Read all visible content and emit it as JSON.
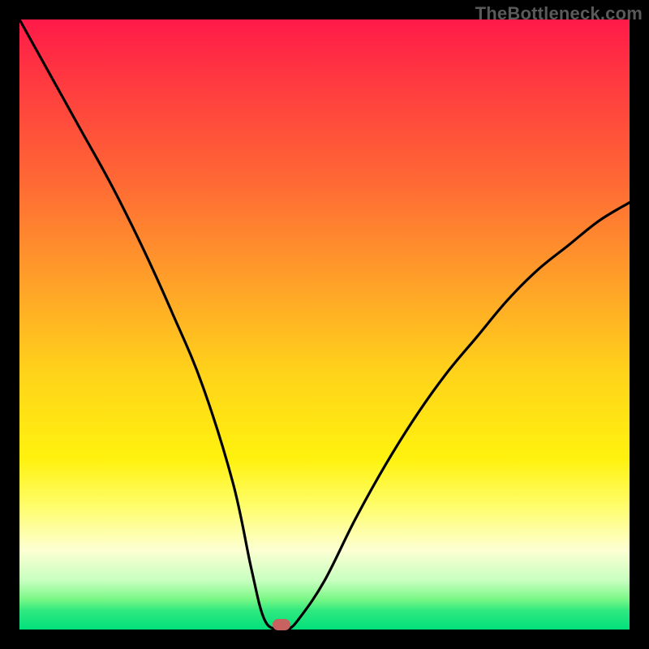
{
  "branding": {
    "text": "TheBottleneck.com"
  },
  "colors": {
    "curve": "#000000",
    "marker": "#c76260",
    "frame": "#000000"
  },
  "chart_data": {
    "type": "line",
    "title": "",
    "xlabel": "",
    "ylabel": "",
    "xlim": [
      0,
      100
    ],
    "ylim": [
      0,
      100
    ],
    "grid": false,
    "series": [
      {
        "name": "bottleneck-curve",
        "x": [
          0,
          5,
          10,
          15,
          20,
          25,
          30,
          35,
          38,
          40,
          42,
          44,
          46,
          50,
          55,
          60,
          65,
          70,
          75,
          80,
          85,
          90,
          95,
          100
        ],
        "values": [
          100,
          91,
          82,
          73,
          63,
          52,
          40,
          24,
          10,
          2,
          0,
          0,
          2,
          8,
          18,
          27,
          35,
          42,
          48,
          54,
          59,
          63,
          67,
          70
        ]
      }
    ],
    "marker": {
      "x": 43,
      "y": 0
    },
    "background_gradient": {
      "stops": [
        {
          "p": 0,
          "c": "#ff1a49"
        },
        {
          "p": 10,
          "c": "#ff3940"
        },
        {
          "p": 27,
          "c": "#ff6a34"
        },
        {
          "p": 45,
          "c": "#ffa727"
        },
        {
          "p": 58,
          "c": "#ffd31a"
        },
        {
          "p": 72,
          "c": "#fff20e"
        },
        {
          "p": 80,
          "c": "#fffe6e"
        },
        {
          "p": 87,
          "c": "#fdffd3"
        },
        {
          "p": 92,
          "c": "#c7ffbf"
        },
        {
          "p": 95,
          "c": "#7af786"
        },
        {
          "p": 97,
          "c": "#2de87f"
        },
        {
          "p": 100,
          "c": "#02e07c"
        }
      ]
    }
  }
}
